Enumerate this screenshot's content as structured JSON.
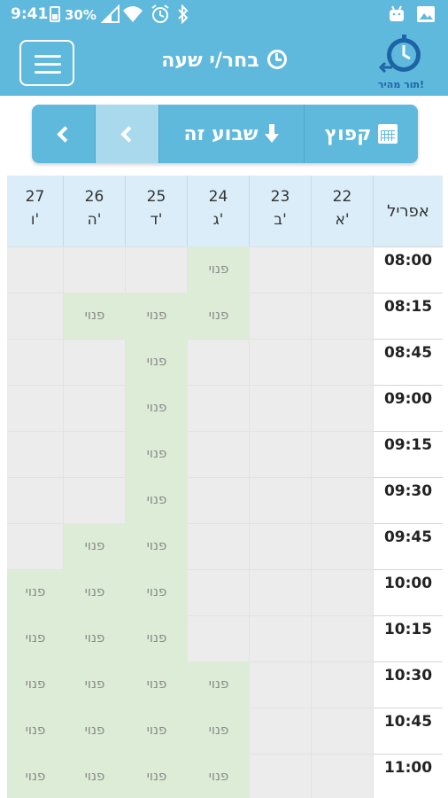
{
  "status_bar": {
    "time": "9:41",
    "battery_pct": "30%",
    "icons": [
      "battery-icon",
      "signal-icon",
      "wifi-icon",
      "alarm-icon",
      "bluetooth-icon",
      "android-icon",
      "image-icon"
    ]
  },
  "header": {
    "title": "בחר/י שעה",
    "logo_text": "תור מהיר!",
    "icons": [
      "menu-icon",
      "clock-icon",
      "stopwatch-logo"
    ]
  },
  "toolbar": {
    "jump_label": "קפוץ",
    "this_week_label": "שבוע זה"
  },
  "schedule": {
    "month": "אפריל",
    "free_label": "פנוי",
    "days": [
      {
        "num": "22",
        "name": "א'"
      },
      {
        "num": "23",
        "name": "ב'"
      },
      {
        "num": "24",
        "name": "ג'"
      },
      {
        "num": "25",
        "name": "ד'"
      },
      {
        "num": "26",
        "name": "ה'"
      },
      {
        "num": "27",
        "name": "ו'"
      }
    ],
    "rows": [
      {
        "time": "08:00",
        "slots": [
          "taken",
          "taken",
          "free",
          "taken",
          "taken",
          "taken"
        ]
      },
      {
        "time": "08:15",
        "slots": [
          "taken",
          "taken",
          "free",
          "free",
          "free",
          "taken"
        ]
      },
      {
        "time": "08:45",
        "slots": [
          "taken",
          "taken",
          "taken",
          "free",
          "taken",
          "taken"
        ]
      },
      {
        "time": "09:00",
        "slots": [
          "taken",
          "taken",
          "taken",
          "free",
          "taken",
          "taken"
        ]
      },
      {
        "time": "09:15",
        "slots": [
          "taken",
          "taken",
          "taken",
          "free",
          "taken",
          "taken"
        ]
      },
      {
        "time": "09:30",
        "slots": [
          "taken",
          "taken",
          "taken",
          "free",
          "taken",
          "taken"
        ]
      },
      {
        "time": "09:45",
        "slots": [
          "taken",
          "taken",
          "taken",
          "free",
          "free",
          "taken"
        ]
      },
      {
        "time": "10:00",
        "slots": [
          "taken",
          "taken",
          "taken",
          "free",
          "free",
          "free"
        ]
      },
      {
        "time": "10:15",
        "slots": [
          "taken",
          "taken",
          "taken",
          "free",
          "free",
          "free"
        ]
      },
      {
        "time": "10:30",
        "slots": [
          "taken",
          "taken",
          "free",
          "free",
          "free",
          "free"
        ]
      },
      {
        "time": "10:45",
        "slots": [
          "taken",
          "taken",
          "free",
          "free",
          "free",
          "free"
        ]
      },
      {
        "time": "11:00",
        "slots": [
          "taken",
          "taken",
          "free",
          "free",
          "free",
          "free"
        ]
      }
    ]
  },
  "colors": {
    "brand": "#5fb9dc",
    "free_slot": "#dcecd6",
    "taken_slot": "#ececec",
    "day_header": "#daedf8"
  }
}
